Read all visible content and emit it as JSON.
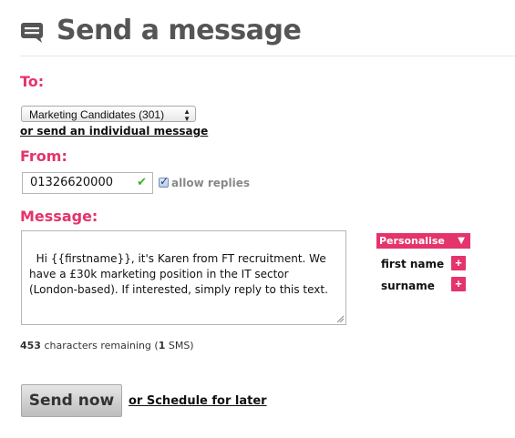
{
  "header": {
    "title": "Send a message",
    "icon": "chat-bubble-icon"
  },
  "to": {
    "label": "To:",
    "selected": "Marketing Candidates (301)",
    "individual_link": "or send an individual message"
  },
  "from": {
    "label": "From:",
    "value": "01326620000",
    "allow_replies_label": "allow replies",
    "allow_replies_checked": true
  },
  "message": {
    "label": "Message:",
    "text": "Hi {{firstname}}, it's Karen from FT recruitment. We have a £30k marketing position in the IT sector (London-based). If interested, simply reply to this text.",
    "chars_remaining": "453",
    "chars_text": " characters remaining (",
    "sms_count": "1",
    "sms_suffix": " SMS)"
  },
  "personalise": {
    "title": "Personalise",
    "items": [
      {
        "label": "first name"
      },
      {
        "label": "surname"
      }
    ]
  },
  "actions": {
    "send_label": "Send now",
    "schedule_link": "or Schedule for later"
  },
  "colors": {
    "accent": "#e5336b",
    "check": "#3fae2a"
  }
}
